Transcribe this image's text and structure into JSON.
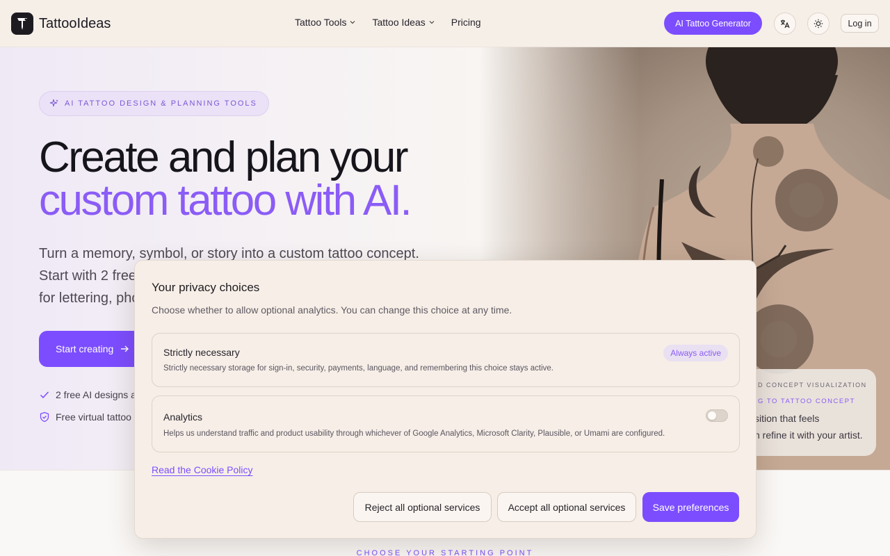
{
  "header": {
    "brand": "TattooIdeas",
    "nav": [
      {
        "label": "Tattoo Tools",
        "has_dropdown": true
      },
      {
        "label": "Tattoo Ideas",
        "has_dropdown": true
      },
      {
        "label": "Pricing",
        "has_dropdown": false
      }
    ],
    "cta": "AI Tattoo Generator",
    "translate_icon": "translate-icon",
    "theme_icon": "sun-icon",
    "login": "Log in"
  },
  "hero": {
    "badge": "AI TATTOO DESIGN & PLANNING TOOLS",
    "title_line1": "Create and plan your",
    "title_line2": "custom tattoo with AI.",
    "lead_line1": "Turn a memory, symbol, or story into a custom tattoo concept.",
    "lead_line2": "Start with 2 free",
    "lead_line3": "for lettering, pho",
    "start_button": "Start creating",
    "features": [
      {
        "icon": "check-icon",
        "text": "2 free AI designs a"
      },
      {
        "icon": "shield-icon",
        "text": "Free virtual tattoo"
      }
    ],
    "card": {
      "line1": "D CONCEPT VISUALIZATION",
      "line2": "G TO TATTOO CONCEPT",
      "line3": "sition that feels",
      "line4": "n refine it with your artist."
    }
  },
  "section": {
    "eyebrow": "CHOOSE YOUR STARTING POINT"
  },
  "modal": {
    "title": "Your privacy choices",
    "subtitle": "Choose whether to allow optional analytics. You can change this choice at any time.",
    "options": [
      {
        "title": "Strictly necessary",
        "description": "Strictly necessary storage for sign-in, security, payments, language, and remembering this choice stays active.",
        "status": "Always active"
      },
      {
        "title": "Analytics",
        "description": "Helps us understand traffic and product usability through whichever of Google Analytics, Microsoft Clarity, Plausible, or Umami are configured.",
        "enabled": false
      }
    ],
    "policy_link": "Read the Cookie Policy",
    "reject": "Reject all optional services",
    "accept": "Accept all optional services",
    "save": "Save preferences"
  },
  "colors": {
    "accent": "#7c4dff",
    "accent_text": "#8b5cf6",
    "header_bg": "#f6efe8",
    "modal_bg": "#f7efe7"
  }
}
